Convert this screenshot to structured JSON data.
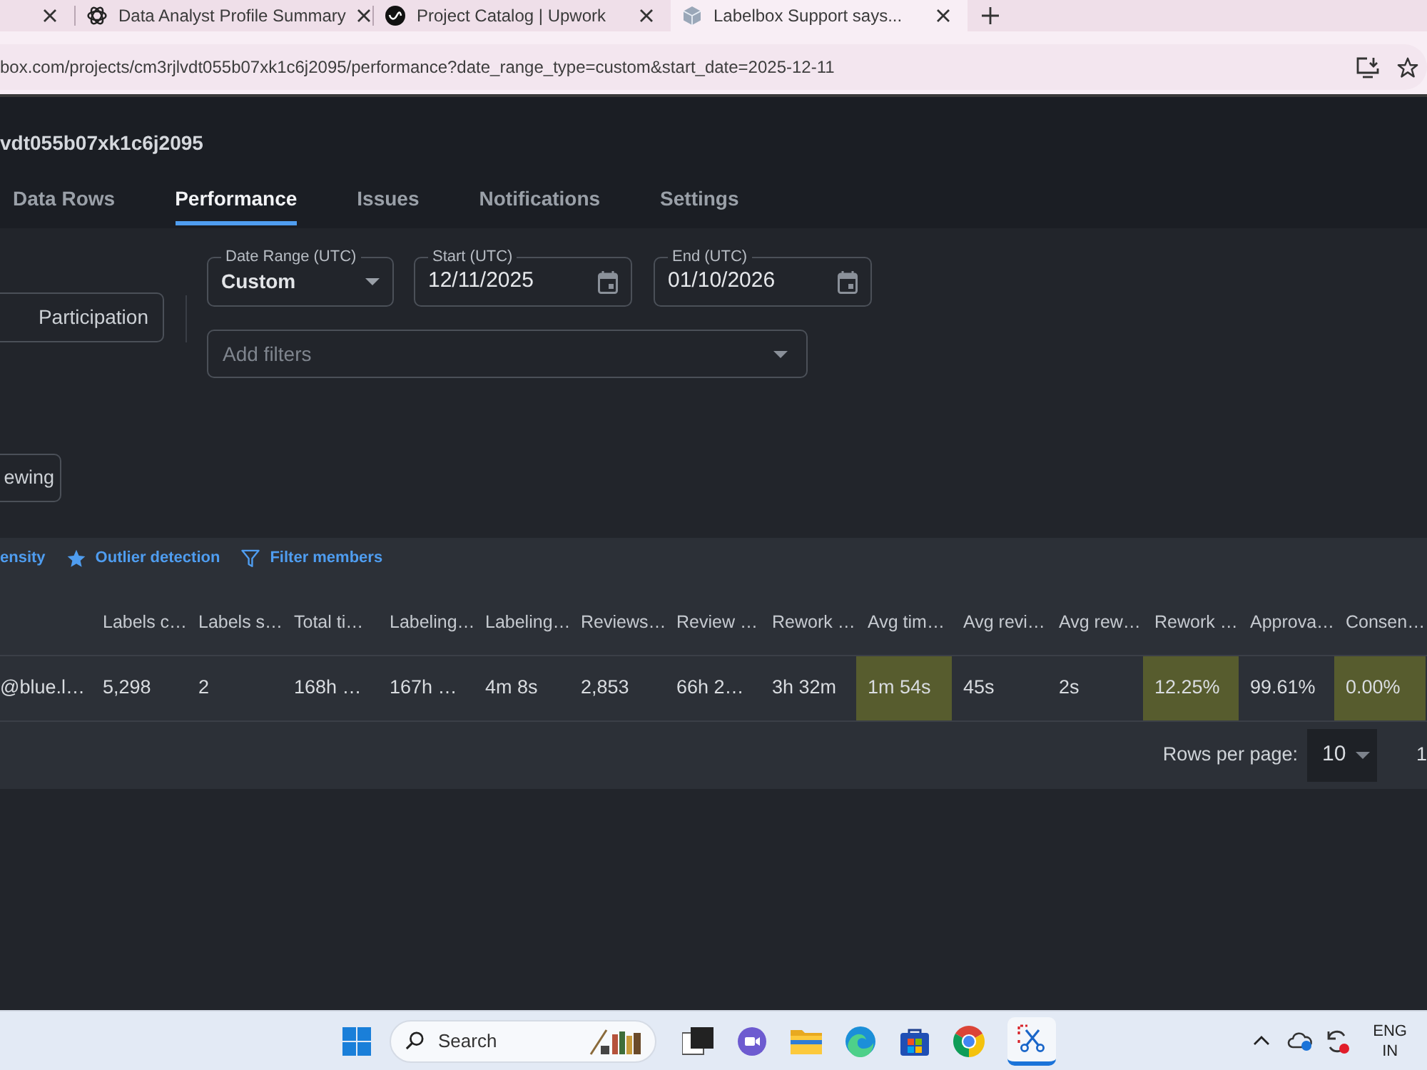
{
  "browser_tabs": [
    {
      "selected": false
    },
    {
      "title": "Data Analyst Profile Summary",
      "selected": false
    },
    {
      "title": "Project Catalog | Upwork",
      "selected": false
    },
    {
      "title": "Labelbox Support says...",
      "selected": true
    }
  ],
  "address_bar": {
    "url": "box.com/projects/cm3rjlvdt055b07xk1c6j2095/performance?date_range_type=custom&start_date=2025-12-11"
  },
  "project": {
    "title": "vdt055b07xk1c6j2095"
  },
  "nav_tabs": [
    {
      "label": "Data Rows",
      "selected": false
    },
    {
      "label": "Performance",
      "selected": true
    },
    {
      "label": "Issues",
      "selected": false
    },
    {
      "label": "Notifications",
      "selected": false
    },
    {
      "label": "Settings",
      "selected": false
    }
  ],
  "view_buttons": [
    {
      "label": "Participation"
    },
    {
      "label": "ewing"
    }
  ],
  "filters": {
    "date_range": {
      "label": "Date Range (UTC)",
      "value": "Custom"
    },
    "start": {
      "label": "Start (UTC)",
      "value": "12/11/2025"
    },
    "end": {
      "label": "End (UTC)",
      "value": "01/10/2026"
    },
    "add_filters": {
      "placeholder": "Add filters"
    }
  },
  "table": {
    "toolbar": [
      {
        "kind": "density",
        "label": "ensity"
      },
      {
        "kind": "outliers",
        "label": "Outlier detection"
      },
      {
        "kind": "filter",
        "label": "Filter members"
      }
    ],
    "columns": [
      "",
      "Labels c…",
      "Labels s…",
      "Total ti…",
      "Labeling…",
      "Labeling…",
      "Reviews…",
      "Review …",
      "Rework …",
      "Avg tim…",
      "Avg revi…",
      "Avg rew…",
      "Rework …",
      "Approva…",
      "Consen…"
    ],
    "rows": [
      {
        "cells": [
          {
            "text": "@blue.l…",
            "highlighted": false
          },
          {
            "text": "5,298",
            "highlighted": false
          },
          {
            "text": "2",
            "highlighted": false
          },
          {
            "text": "168h …",
            "highlighted": false
          },
          {
            "text": "167h …",
            "highlighted": false
          },
          {
            "text": "4m 8s",
            "highlighted": false
          },
          {
            "text": "2,853",
            "highlighted": false
          },
          {
            "text": "66h 2…",
            "highlighted": false
          },
          {
            "text": "3h 32m",
            "highlighted": false
          },
          {
            "text": "1m 54s",
            "highlighted": true
          },
          {
            "text": "45s",
            "highlighted": false
          },
          {
            "text": "2s",
            "highlighted": false
          },
          {
            "text": "12.25%",
            "highlighted": true
          },
          {
            "text": "99.61%",
            "highlighted": false
          },
          {
            "text": "0.00%",
            "highlighted": true
          }
        ]
      }
    ],
    "pagination": {
      "label": "Rows per page:",
      "rows_per_page": "10",
      "range": "1"
    }
  },
  "taskbar": {
    "search": "Search",
    "language": "ENG",
    "region": "IN"
  }
}
